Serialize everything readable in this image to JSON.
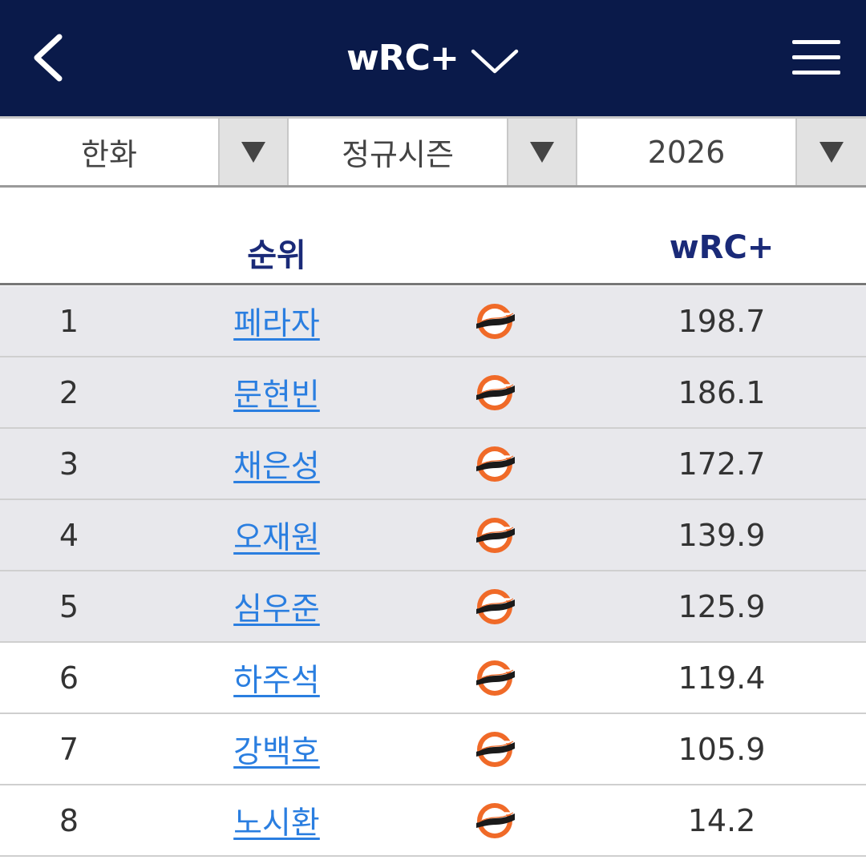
{
  "header": {
    "title": "wRC+",
    "back_icon": "chevron-left-icon",
    "title_dropdown_icon": "chevron-down-icon",
    "menu_icon": "hamburger-menu-icon"
  },
  "filters": [
    {
      "value": "한화"
    },
    {
      "value": "정규시즌"
    },
    {
      "value": "2026"
    }
  ],
  "table": {
    "columns": {
      "rank": "순위",
      "metric": "wRC+"
    },
    "team_logo_icon": "eagles-logo-icon",
    "rows": [
      {
        "rank": "1",
        "name": "페라자",
        "value": "198.7"
      },
      {
        "rank": "2",
        "name": "문현빈",
        "value": "186.1"
      },
      {
        "rank": "3",
        "name": "채은성",
        "value": "172.7"
      },
      {
        "rank": "4",
        "name": "오재원",
        "value": "139.9"
      },
      {
        "rank": "5",
        "name": "심우준",
        "value": "125.9"
      },
      {
        "rank": "6",
        "name": "하주석",
        "value": "119.4"
      },
      {
        "rank": "7",
        "name": "강백호",
        "value": "105.9"
      },
      {
        "rank": "8",
        "name": "노시환",
        "value": "14.2"
      }
    ]
  },
  "colors": {
    "header_bg": "#0a1a4a",
    "link": "#2a7ee0",
    "column_header": "#1a2a78",
    "logo_orange": "#f06a28"
  }
}
